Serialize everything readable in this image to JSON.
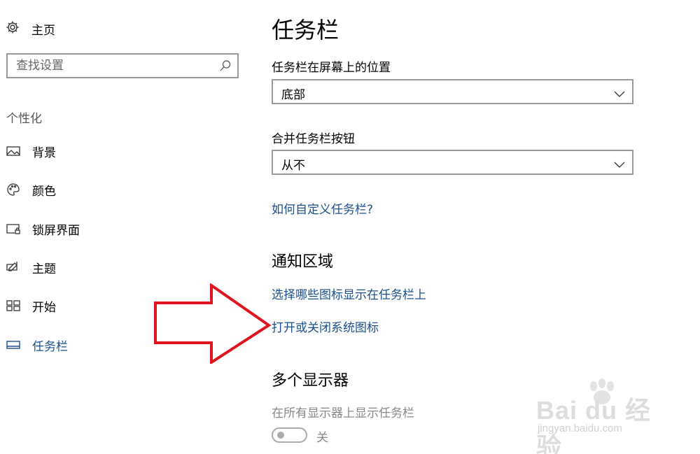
{
  "nav": {
    "home": {
      "label": "主页",
      "icon": "gear-icon"
    },
    "search": {
      "placeholder": "查找设置",
      "icon": "search-icon"
    },
    "section_label": "个性化",
    "items": [
      {
        "label": "背景",
        "icon": "picture-icon",
        "active": false
      },
      {
        "label": "颜色",
        "icon": "palette-icon",
        "active": false
      },
      {
        "label": "锁屏界面",
        "icon": "lock-screen-icon",
        "active": false
      },
      {
        "label": "主题",
        "icon": "theme-brush-icon",
        "active": false
      },
      {
        "label": "开始",
        "icon": "start-grid-icon",
        "active": false
      },
      {
        "label": "任务栏",
        "icon": "taskbar-icon",
        "active": true
      }
    ]
  },
  "main": {
    "title": "任务栏",
    "position": {
      "label": "任务栏在屏幕上的位置",
      "value": "底部"
    },
    "combine": {
      "label": "合并任务栏按钮",
      "value": "从不"
    },
    "customize_link": "如何自定义任务栏?",
    "notification_area": {
      "heading": "通知区域",
      "link_icons": "选择哪些图标显示在任务栏上",
      "link_system_icons": "打开或关闭系统图标"
    },
    "multi_display": {
      "heading": "多个显示器",
      "show_all_label": "在所有显示器上显示任务栏",
      "toggle_state": "关",
      "toggle_on": false
    }
  },
  "colors": {
    "accent": "#1a4f8b",
    "arrow": "#e0141e",
    "disabled": "#888888"
  },
  "watermark": {
    "brand": "Bai du 经验",
    "url": "jingyan.baidu.com"
  }
}
